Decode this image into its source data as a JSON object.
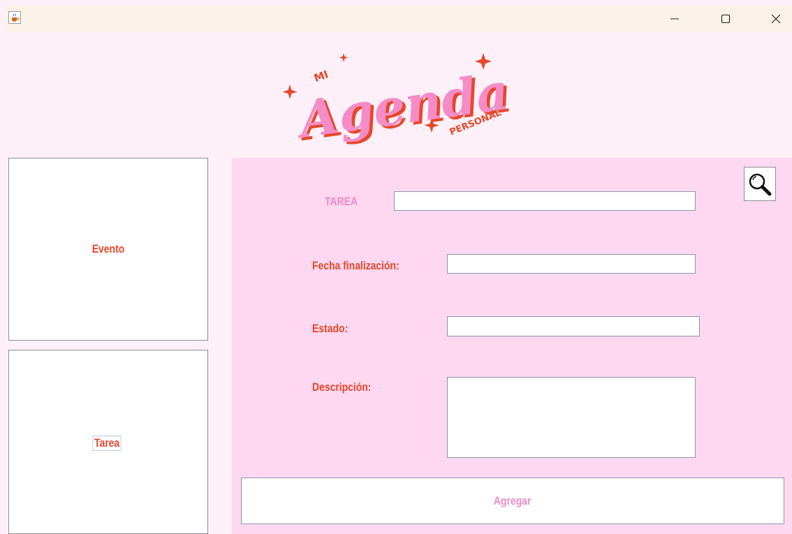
{
  "window": {
    "title": "",
    "controls": {
      "minimize": "minimize-icon",
      "maximize": "maximize-icon",
      "close": "close-icon"
    }
  },
  "header": {
    "logo": {
      "small_top": "MI",
      "main": "Agenda",
      "small_bottom": "PERSONAL"
    }
  },
  "sidebar": {
    "items": [
      {
        "label": "Evento"
      },
      {
        "label": "Tarea"
      }
    ]
  },
  "form": {
    "title_label": "TAREA",
    "title_value": "",
    "end_date_label": "Fecha finalización:",
    "end_date_value": "",
    "status_label": "Estado:",
    "status_value": "",
    "description_label": "Descripción:",
    "description_value": "",
    "submit_label": "Agregar",
    "search_icon": "search-icon"
  },
  "colors": {
    "page_bg": "#fef0f8",
    "panel_bg": "#fed8f0",
    "accent_orange": "#e8472a",
    "accent_pink": "#f08ac8",
    "titlebar_bg": "#faf2e8"
  }
}
